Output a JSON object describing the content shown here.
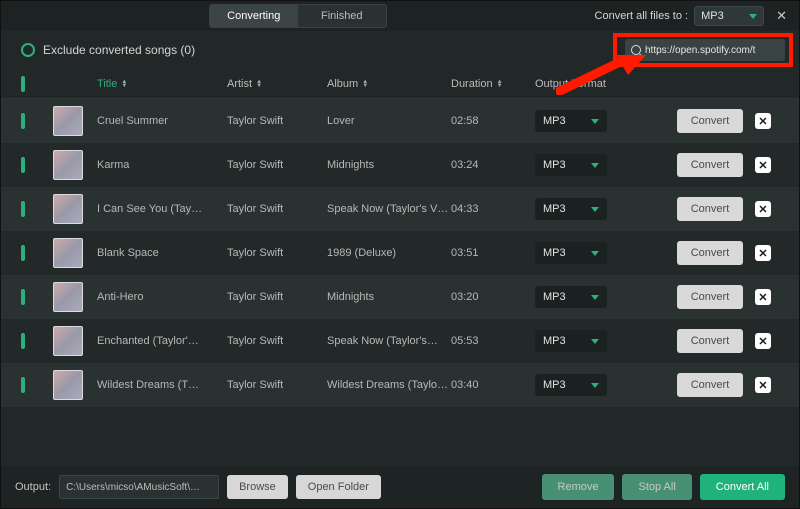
{
  "topbar": {
    "tab_converting": "Converting",
    "tab_finished": "Finished",
    "convert_all_label": "Convert all files to :",
    "convert_all_value": "MP3"
  },
  "exclude_label": "Exclude converted songs (0)",
  "url_input": "https://open.spotify.com/t",
  "headers": {
    "title": "Title",
    "artist": "Artist",
    "album": "Album",
    "duration": "Duration",
    "format": "Output Format"
  },
  "convert_label": "Convert",
  "tracks": [
    {
      "title": "Cruel Summer",
      "artist": "Taylor Swift",
      "album": "Lover",
      "duration": "02:58",
      "format": "MP3"
    },
    {
      "title": "Karma",
      "artist": "Taylor Swift",
      "album": "Midnights",
      "duration": "03:24",
      "format": "MP3"
    },
    {
      "title": "I Can See You (Tay…",
      "artist": "Taylor Swift",
      "album": "Speak Now (Taylor's V…",
      "duration": "04:33",
      "format": "MP3"
    },
    {
      "title": "Blank Space",
      "artist": "Taylor Swift",
      "album": "1989 (Deluxe)",
      "duration": "03:51",
      "format": "MP3"
    },
    {
      "title": "Anti-Hero",
      "artist": "Taylor Swift",
      "album": "Midnights",
      "duration": "03:20",
      "format": "MP3"
    },
    {
      "title": "Enchanted (Taylor'…",
      "artist": "Taylor Swift",
      "album": "Speak Now (Taylor's…",
      "duration": "05:53",
      "format": "MP3"
    },
    {
      "title": "Wildest Dreams (T…",
      "artist": "Taylor Swift",
      "album": "Wildest Dreams (Taylo…",
      "duration": "03:40",
      "format": "MP3"
    }
  ],
  "footer": {
    "output_label": "Output:",
    "output_path": "C:\\Users\\micso\\AMusicSoft\\…",
    "browse": "Browse",
    "open_folder": "Open Folder",
    "remove": "Remove",
    "stop_all": "Stop All",
    "convert_all": "Convert All"
  }
}
